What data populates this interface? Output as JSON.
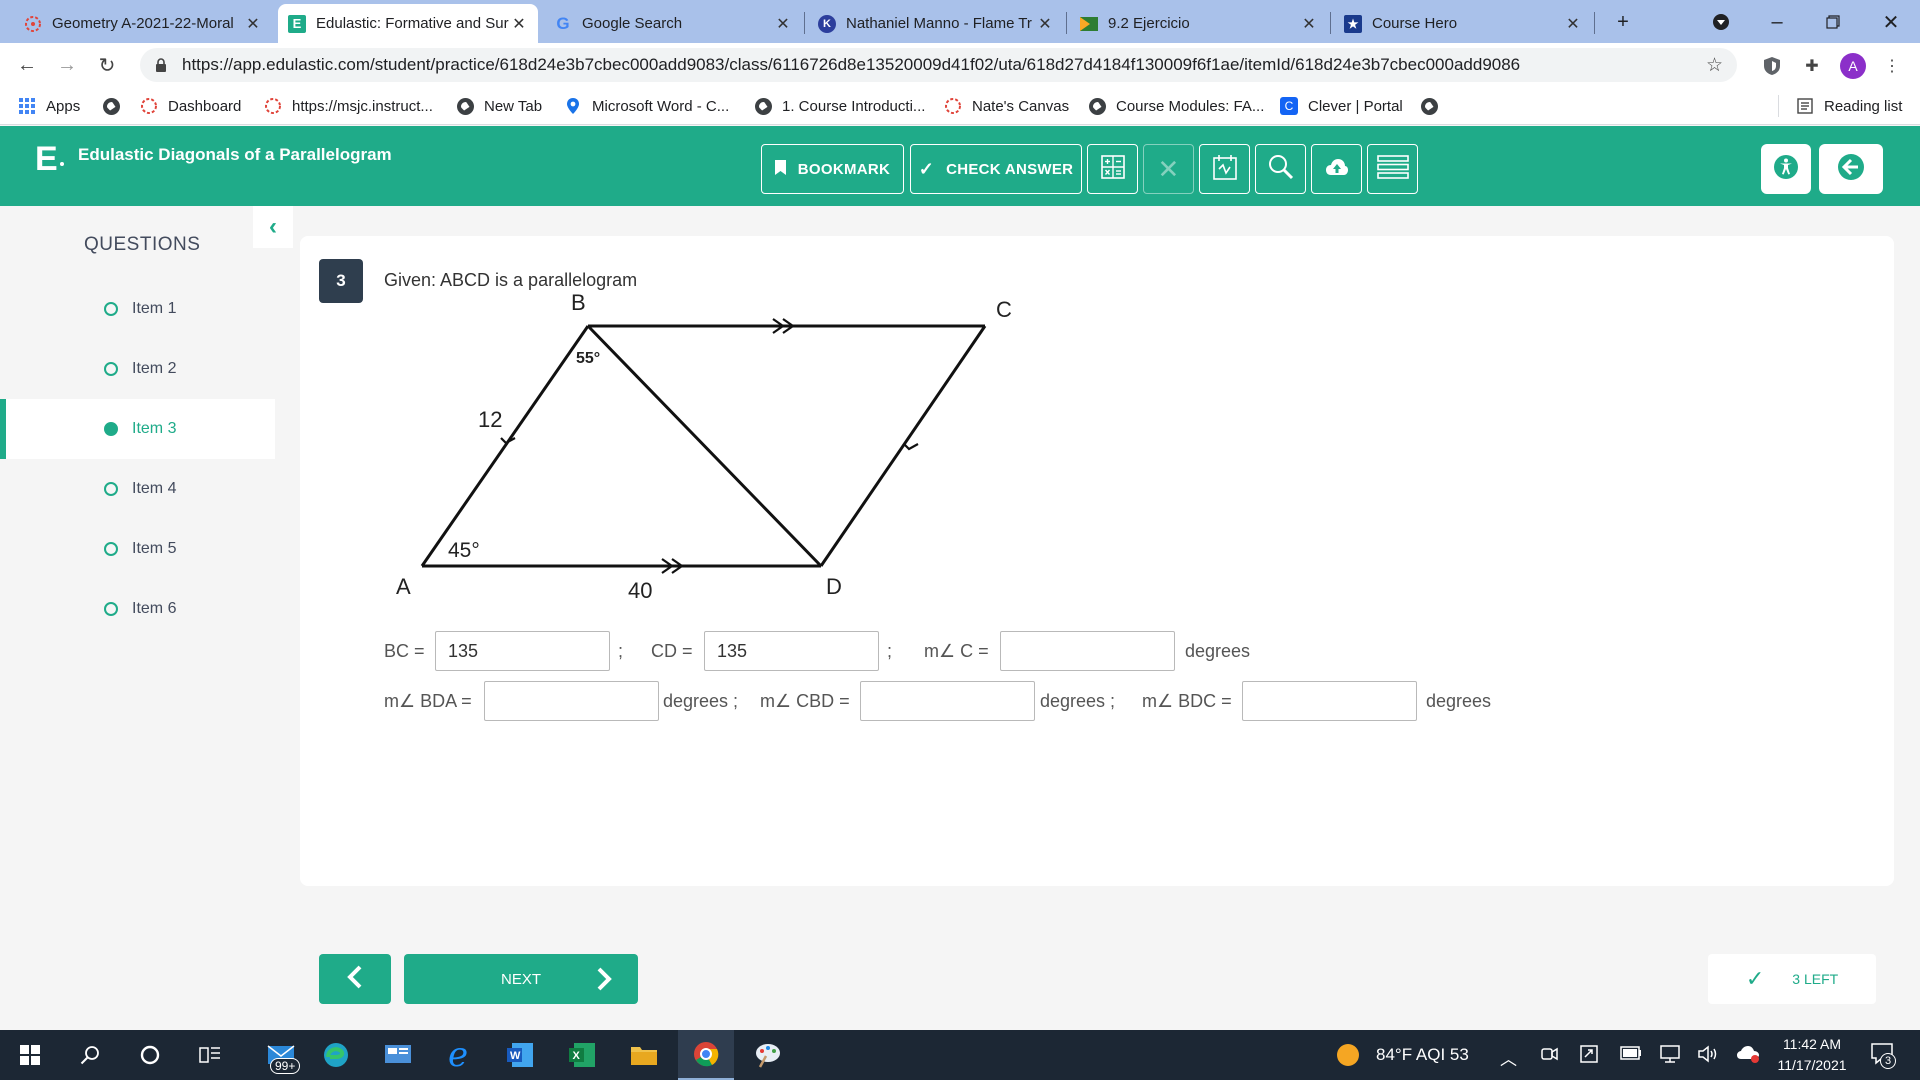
{
  "browser": {
    "tabs": [
      {
        "title": "Geometry A-2021-22-Moral",
        "icon": "canvas-icon",
        "active": false
      },
      {
        "title": "Edulastic: Formative and Sur",
        "icon": "edulastic-icon",
        "active": true
      },
      {
        "title": "Google Search",
        "icon": "google-icon",
        "active": false
      },
      {
        "title": "Nathaniel Manno - Flame Tr",
        "icon": "k-icon",
        "active": false
      },
      {
        "title": "9.2 Ejercicio",
        "icon": "flag-icon",
        "active": false
      },
      {
        "title": "Course Hero",
        "icon": "star-badge-icon",
        "active": false
      }
    ],
    "url": "https://app.edulastic.com/student/practice/618d24e3b7cbec000add9083/class/6116726d8e13520009d41f02/uta/618d27d4184f130009f6f1ae/itemId/618d24e3b7cbec000add9086",
    "avatar_letter": "A",
    "bookmarks": [
      {
        "label": "Apps",
        "icon": "apps-grid-icon"
      },
      {
        "label": "",
        "icon": "globe-icon"
      },
      {
        "label": "Dashboard",
        "icon": "canvas-icon"
      },
      {
        "label": "https://msjc.instruct...",
        "icon": "canvas-icon"
      },
      {
        "label": "New Tab",
        "icon": "globe-icon"
      },
      {
        "label": "Microsoft Word - C...",
        "icon": "location-pin-icon"
      },
      {
        "label": "1. Course Introducti...",
        "icon": "globe-icon"
      },
      {
        "label": "Nate's Canvas",
        "icon": "canvas-icon"
      },
      {
        "label": "Course Modules: FA...",
        "icon": "globe-icon"
      },
      {
        "label": "Clever | Portal",
        "icon": "clever-icon"
      },
      {
        "label": "",
        "icon": "globe-icon"
      }
    ],
    "reading_list": "Reading list"
  },
  "app": {
    "logo": "E",
    "title": "Edulastic Diagonals of a Parallelogram",
    "bookmark_label": "BOOKMARK",
    "check_answer_label": "CHECK ANSWER",
    "accent_color": "#1fab89"
  },
  "sidebar": {
    "title": "QUESTIONS",
    "items": [
      {
        "label": "Item 1",
        "active": false
      },
      {
        "label": "Item 2",
        "active": false
      },
      {
        "label": "Item 3",
        "active": true
      },
      {
        "label": "Item 4",
        "active": false
      },
      {
        "label": "Item 5",
        "active": false
      },
      {
        "label": "Item 6",
        "active": false
      }
    ]
  },
  "question": {
    "number": "3",
    "given": "Given:  ABCD is a parallelogram",
    "figure": {
      "vertex_a": "A",
      "vertex_b": "B",
      "vertex_c": "C",
      "vertex_d": "D",
      "angle_b": "55°",
      "angle_a": "45°",
      "side_ab": "12",
      "side_ad": "40"
    },
    "fields": {
      "bc_label": "BC =",
      "bc_value": "135",
      "sep1": ";",
      "cd_label": "CD =",
      "cd_value": "135",
      "sep2": ";",
      "mc_label": "m∠ C =",
      "mc_value": "",
      "mc_unit": "degrees",
      "bda_label": "m∠ BDA =",
      "bda_value": "",
      "bda_unit": "degrees ;",
      "cbd_label": "m∠ CBD =",
      "cbd_value": "",
      "cbd_unit": "degrees ;",
      "bdc_label": "m∠ BDC =",
      "bdc_value": "",
      "bdc_unit": "degrees"
    }
  },
  "footer": {
    "next_label": "NEXT",
    "left_label": "3 LEFT"
  },
  "taskbar": {
    "mail_badge": "99+",
    "weather": "84°F  AQI 53",
    "time": "11:42 AM",
    "date": "11/17/2021",
    "notifications": "3"
  }
}
